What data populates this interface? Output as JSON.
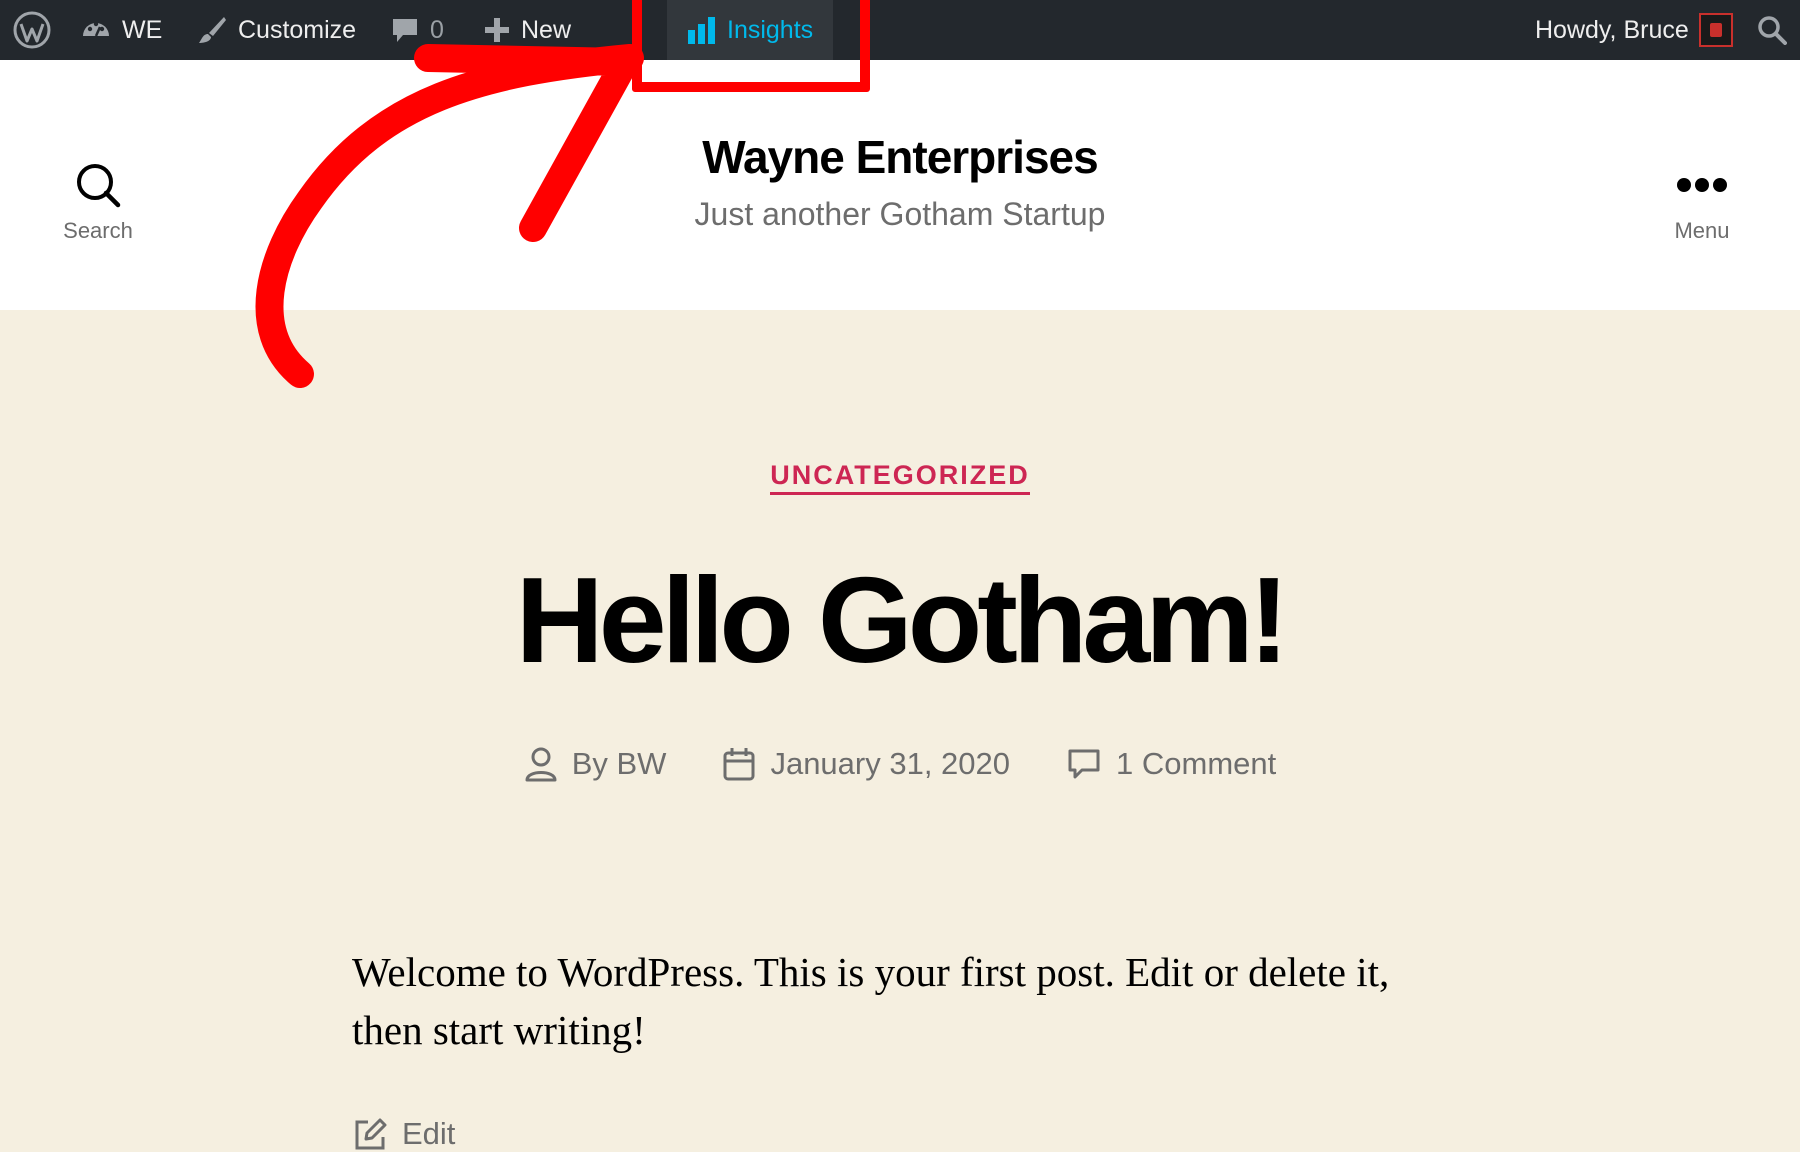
{
  "adminbar": {
    "site_name": "WE",
    "customize_label": "Customize",
    "comments_count": "0",
    "new_label": "New",
    "insights_label": "Insights",
    "greeting": "Howdy, Bruce",
    "icons": [
      "wordpress-logo",
      "dashboard-palette",
      "paintbrush",
      "comment-bubble",
      "plus",
      "bar-chart",
      "avatar",
      "search"
    ]
  },
  "header": {
    "site_title": "Wayne Enterprises",
    "site_description": "Just another Gotham Startup",
    "search_label": "Search",
    "menu_label": "Menu"
  },
  "post": {
    "category": "UNCATEGORIZED",
    "title": "Hello Gotham!",
    "author": "By BW",
    "date": "January 31, 2020",
    "comments": "1 Comment",
    "content": "Welcome to WordPress. This is your first post. Edit or delete it, then start writing!",
    "edit_label": "Edit"
  },
  "colors": {
    "adminbar_bg": "#23282d",
    "insights_accent": "#00b9eb",
    "category_accent": "#cd2653",
    "page_bg": "#f5efe0",
    "annotation": "#ff0000"
  }
}
